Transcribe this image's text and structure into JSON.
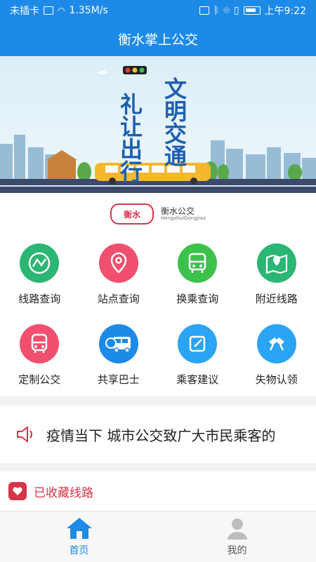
{
  "status_bar": {
    "carrier": "未插卡",
    "speed": "1.35M/s",
    "time": "上午9:22"
  },
  "header": {
    "title": "衡水掌上公交"
  },
  "banner": {
    "text_left": "礼让出行",
    "text_right": "文明交通"
  },
  "logo": {
    "mark": "衡水",
    "name": "衡水公交",
    "pinyin": "HengshuiGongjiao"
  },
  "menu": {
    "items": [
      {
        "label": "线路查询",
        "icon": "route-icon",
        "color": "#2bb673"
      },
      {
        "label": "站点查询",
        "icon": "location-pin-icon",
        "color": "#f0506e"
      },
      {
        "label": "换乘查询",
        "icon": "bus-transfer-icon",
        "color": "#3cc24b"
      },
      {
        "label": "附近线路",
        "icon": "nearby-map-icon",
        "color": "#2bb673"
      },
      {
        "label": "定制公交",
        "icon": "custom-bus-icon",
        "color": "#f0506e"
      },
      {
        "label": "共享巴士",
        "icon": "shared-bus-icon",
        "color": "#1e8ae8"
      },
      {
        "label": "乘客建议",
        "icon": "edit-note-icon",
        "color": "#2aa4f4"
      },
      {
        "label": "失物认领",
        "icon": "lost-found-icon",
        "color": "#2aa4f4"
      }
    ]
  },
  "notice": {
    "text": "疫情当下  城市公交致广大市民乘客的"
  },
  "favorites": {
    "label": "已收藏线路"
  },
  "tabbar": {
    "home": "首页",
    "mine": "我的",
    "active_color": "#1e8ae8",
    "inactive_color": "#555555"
  }
}
